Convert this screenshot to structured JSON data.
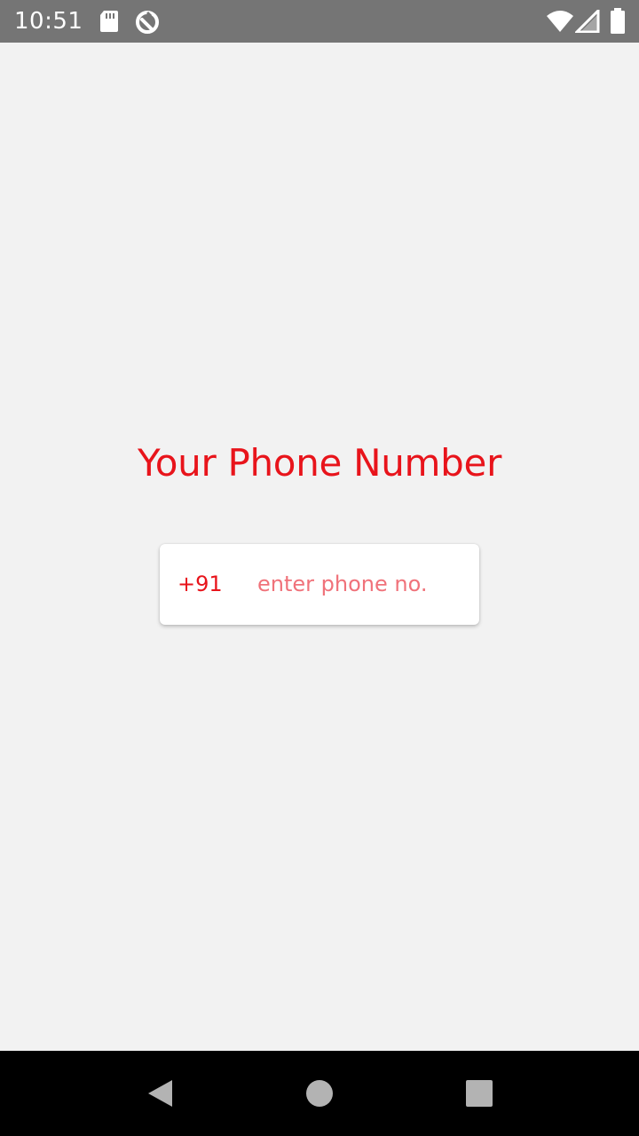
{
  "status_bar": {
    "time": "10:51",
    "icons": [
      "sd-card-icon",
      "sync-icon",
      "wifi-icon",
      "signal-icon",
      "battery-icon"
    ]
  },
  "main": {
    "title": "Your Phone Number",
    "country_code": "+91",
    "phone_placeholder": "enter phone no.",
    "phone_value": ""
  },
  "nav_bar": {
    "icons": [
      "back-icon",
      "home-icon",
      "recents-icon"
    ]
  },
  "colors": {
    "accent": "#e8141b",
    "placeholder": "#f0727a",
    "background": "#f2f2f2",
    "status_bar": "#757575",
    "nav_bar": "#000000"
  }
}
